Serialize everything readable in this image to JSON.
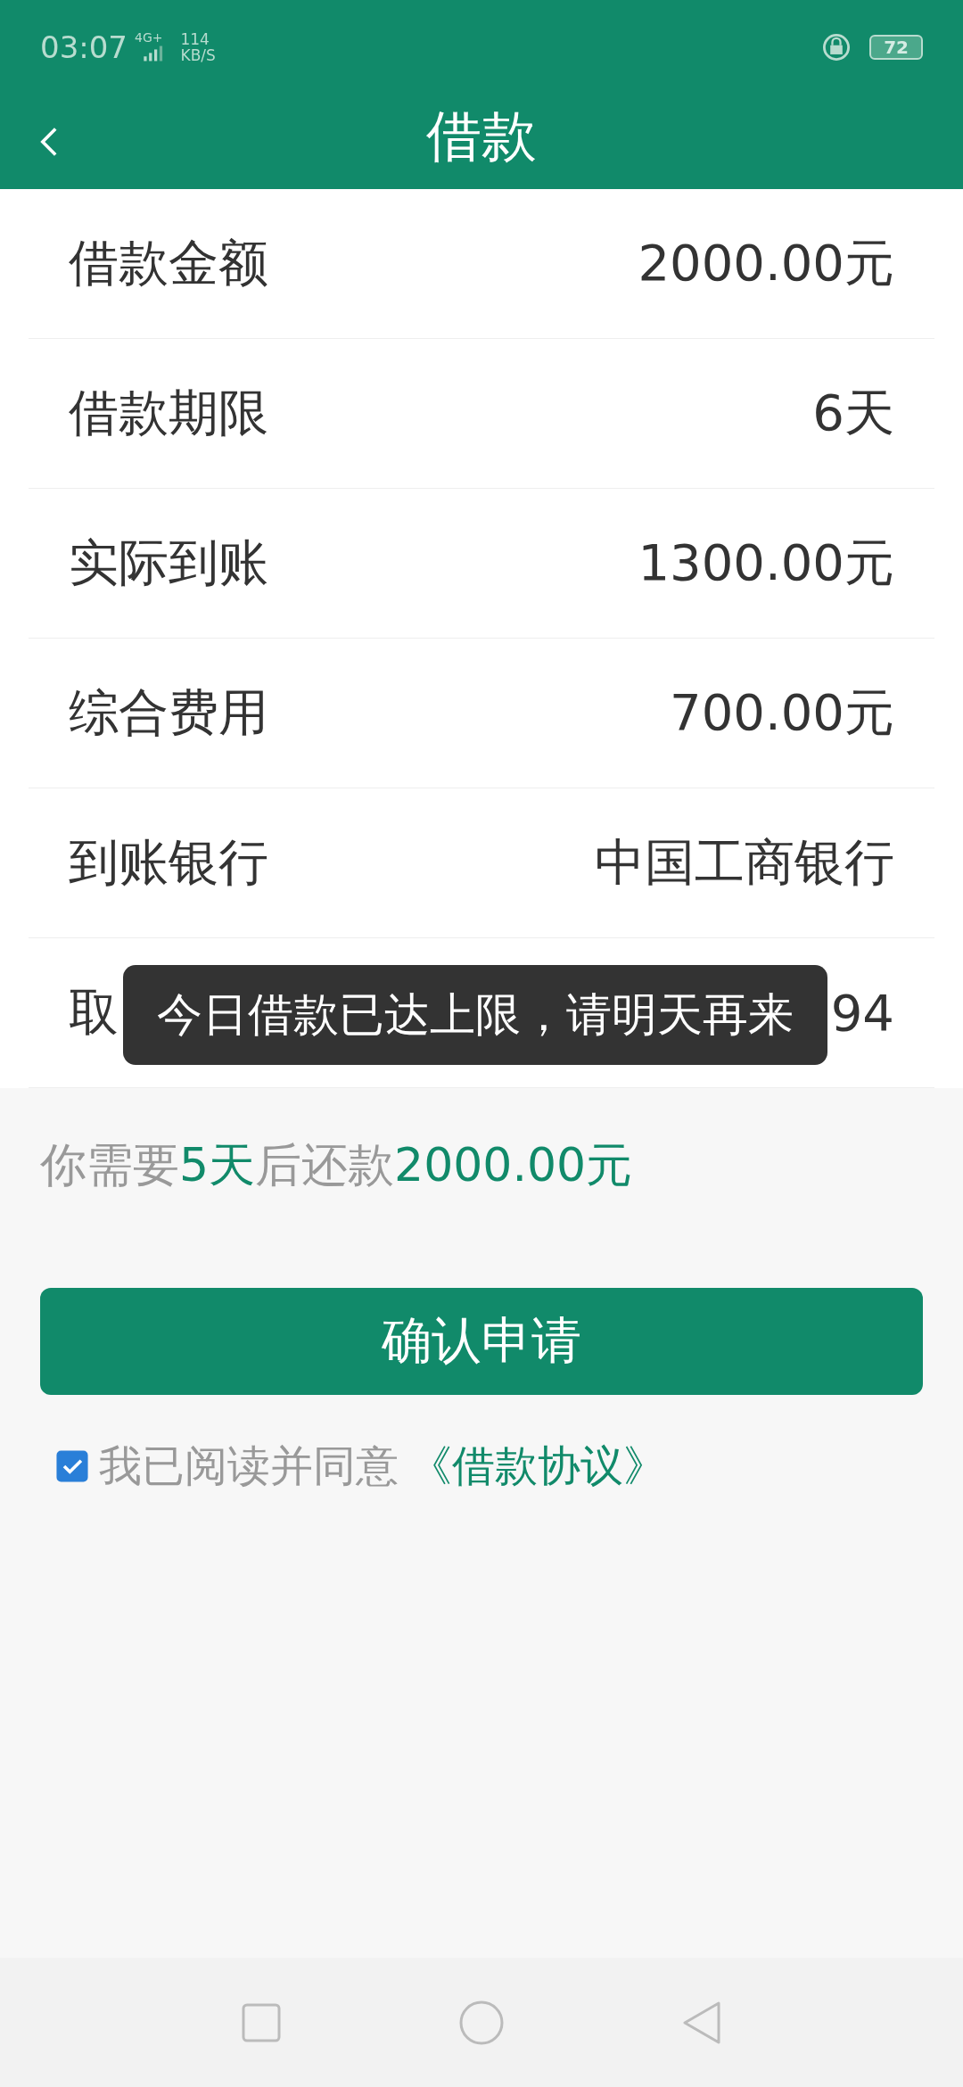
{
  "status_bar": {
    "time": "03:07",
    "network": "4G+",
    "speed_value": "114",
    "speed_unit": "KB/S",
    "battery": "72"
  },
  "header": {
    "title": "借款"
  },
  "rows": [
    {
      "label": "借款金额",
      "value": "2000.00元"
    },
    {
      "label": "借款期限",
      "value": "6天"
    },
    {
      "label": "实际到账",
      "value": "1300.00元"
    },
    {
      "label": "综合费用",
      "value": "700.00元"
    },
    {
      "label": "到账银行",
      "value": "中国工商银行"
    },
    {
      "label": "取",
      "value": "94"
    }
  ],
  "toast": "今日借款已达上限，请明天再来",
  "summary": "你需要**5天**后还款**2000.00元**",
  "confirm_button": "确认申请",
  "agreement": {
    "checked": true,
    "text": "我已阅读并同意",
    "link": "《借款协议》"
  }
}
